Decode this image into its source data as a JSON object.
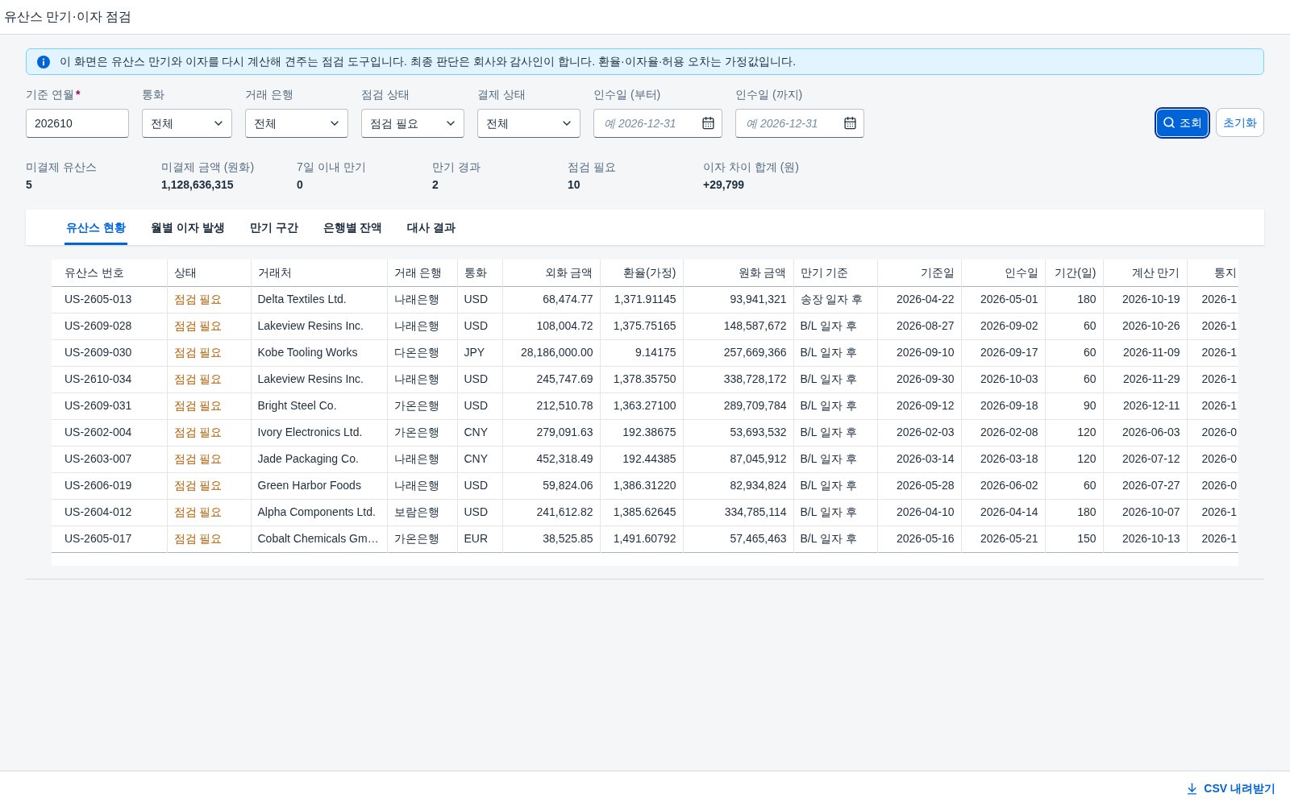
{
  "app_title": "유산스 만기·이자 점검",
  "notice": {
    "text": "이 화면은 유산스 만기와 이자를 다시 계산해 견주는 점검 도구입니다. 최종 판단은 회사와 감사인이 합니다. 환율·이자율·허용 오차는 가정값입니다."
  },
  "filters": [
    {
      "kind": "text",
      "label": "기준 연월",
      "required_mark": "*",
      "value": "202610"
    },
    {
      "kind": "select",
      "label": "통화",
      "value": "전체"
    },
    {
      "kind": "select",
      "label": "거래 은행",
      "value": "전체"
    },
    {
      "kind": "select",
      "label": "점검 상태",
      "value": "점검 필요"
    },
    {
      "kind": "select",
      "label": "결제 상태",
      "value": "전체"
    },
    {
      "kind": "date",
      "label": "인수일 (부터)",
      "placeholder": "예 2026-12-31"
    },
    {
      "kind": "date",
      "label": "인수일 (까지)",
      "placeholder": "예 2026-12-31"
    }
  ],
  "actions": [
    {
      "kind": "primary",
      "label": "조회"
    },
    {
      "kind": "secondary",
      "label": "초기화"
    }
  ],
  "summary": [
    {
      "label": "미결제 유산스",
      "value": "5"
    },
    {
      "label": "미결제 금액 (원화)",
      "value": "1,128,636,315"
    },
    {
      "label": "7일 이내 만기",
      "value": "0"
    },
    {
      "label": "만기 경과",
      "value": "2"
    },
    {
      "label": "점검 필요",
      "value": "10"
    },
    {
      "label": "이자 차이 합계 (원)",
      "value": "+29,799"
    }
  ],
  "tabs": [
    {
      "label": "유산스 현황",
      "selected": true
    },
    {
      "label": "월별 이자 발생",
      "selected": false
    },
    {
      "label": "만기 구간",
      "selected": false
    },
    {
      "label": "은행별 잔액",
      "selected": false
    },
    {
      "label": "대사 결과",
      "selected": false
    }
  ],
  "table": {
    "columns": [
      "유산스 번호",
      "상태",
      "거래처",
      "거래 은행",
      "통화",
      "외화 금액",
      "환율(가정)",
      "원화 금액",
      "만기 기준",
      "기준일",
      "인수일",
      "기간(일)",
      "계산 만기",
      "통지"
    ],
    "rows": [
      {
        "kind": "warning",
        "cells": [
          "US-2605-013",
          "점검 필요",
          "Delta Textiles Ltd.",
          "나래은행",
          "USD",
          "68,474.77",
          "1,371.91145",
          "93,941,321",
          "송장 일자 후",
          "2026-04-22",
          "2026-05-01",
          "180",
          "2026-10-19",
          "2026-1"
        ]
      },
      {
        "kind": "warning",
        "cells": [
          "US-2609-028",
          "점검 필요",
          "Lakeview Resins Inc.",
          "나래은행",
          "USD",
          "108,004.72",
          "1,375.75165",
          "148,587,672",
          "B/L 일자 후",
          "2026-08-27",
          "2026-09-02",
          "60",
          "2026-10-26",
          "2026-1"
        ]
      },
      {
        "kind": "warning",
        "cells": [
          "US-2609-030",
          "점검 필요",
          "Kobe Tooling Works",
          "다온은행",
          "JPY",
          "28,186,000.00",
          "9.14175",
          "257,669,366",
          "B/L 일자 후",
          "2026-09-10",
          "2026-09-17",
          "60",
          "2026-11-09",
          "2026-1"
        ]
      },
      {
        "kind": "warning",
        "cells": [
          "US-2610-034",
          "점검 필요",
          "Lakeview Resins Inc.",
          "나래은행",
          "USD",
          "245,747.69",
          "1,378.35750",
          "338,728,172",
          "B/L 일자 후",
          "2026-09-30",
          "2026-10-03",
          "60",
          "2026-11-29",
          "2026-1"
        ]
      },
      {
        "kind": "warning",
        "cells": [
          "US-2609-031",
          "점검 필요",
          "Bright Steel Co.",
          "가온은행",
          "USD",
          "212,510.78",
          "1,363.27100",
          "289,709,784",
          "B/L 일자 후",
          "2026-09-12",
          "2026-09-18",
          "90",
          "2026-12-11",
          "2026-1"
        ]
      },
      {
        "kind": "warning",
        "cells": [
          "US-2602-004",
          "점검 필요",
          "Ivory Electronics Ltd.",
          "가온은행",
          "CNY",
          "279,091.63",
          "192.38675",
          "53,693,532",
          "B/L 일자 후",
          "2026-02-03",
          "2026-02-08",
          "120",
          "2026-06-03",
          "2026-0"
        ]
      },
      {
        "kind": "warning",
        "cells": [
          "US-2603-007",
          "점검 필요",
          "Jade Packaging Co.",
          "나래은행",
          "CNY",
          "452,318.49",
          "192.44385",
          "87,045,912",
          "B/L 일자 후",
          "2026-03-14",
          "2026-03-18",
          "120",
          "2026-07-12",
          "2026-0"
        ]
      },
      {
        "kind": "warning",
        "cells": [
          "US-2606-019",
          "점검 필요",
          "Green Harbor Foods",
          "나래은행",
          "USD",
          "59,824.06",
          "1,386.31220",
          "82,934,824",
          "B/L 일자 후",
          "2026-05-28",
          "2026-06-02",
          "60",
          "2026-07-27",
          "2026-0"
        ]
      },
      {
        "kind": "warning",
        "cells": [
          "US-2604-012",
          "점검 필요",
          "Alpha Components Ltd.",
          "보람은행",
          "USD",
          "241,612.82",
          "1,385.62645",
          "334,785,114",
          "B/L 일자 후",
          "2026-04-10",
          "2026-04-14",
          "180",
          "2026-10-07",
          "2026-1"
        ]
      },
      {
        "kind": "warning",
        "cells": [
          "US-2605-017",
          "점검 필요",
          "Cobalt Chemicals Gm…",
          "가온은행",
          "EUR",
          "38,525.85",
          "1,491.60792",
          "57,465,463",
          "B/L 일자 후",
          "2026-05-16",
          "2026-05-21",
          "150",
          "2026-10-13",
          "2026-1"
        ]
      }
    ]
  },
  "footer": {
    "export_button": "CSV 내려받기"
  }
}
